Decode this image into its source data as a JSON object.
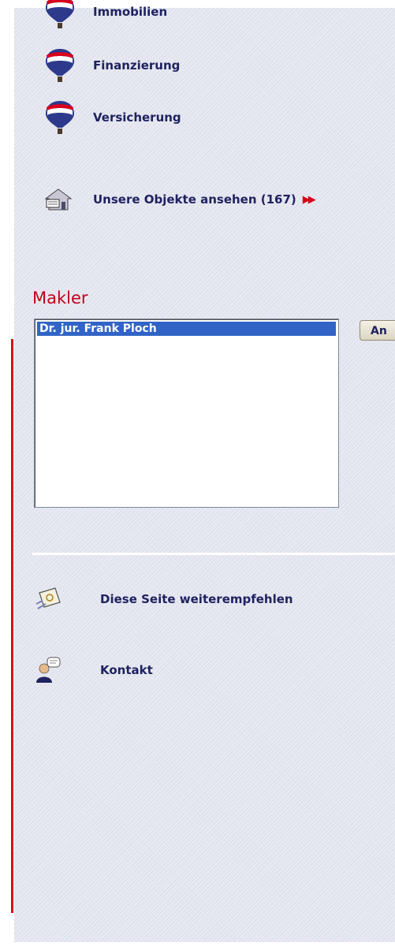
{
  "nav": {
    "items": [
      {
        "label": "Immobilien",
        "icon": "remax-balloon-icon"
      },
      {
        "label": "Finanzierung",
        "icon": "remax-balloon-icon"
      },
      {
        "label": "Versicherung",
        "icon": "remax-balloon-icon"
      }
    ]
  },
  "objects_link": {
    "label": "Unsere Objekte ansehen (167)",
    "arrow": "▶▶",
    "icon": "house-icon"
  },
  "makler": {
    "title": "Makler",
    "options": [
      "Dr. jur. Frank Ploch"
    ],
    "selected": "Dr. jur. Frank Ploch",
    "button_label": "An"
  },
  "footer_links": [
    {
      "label": "Diese Seite weiterempfehlen",
      "icon": "recommend-icon"
    },
    {
      "label": "Kontakt",
      "icon": "contact-person-icon"
    }
  ],
  "colors": {
    "accent_red": "#c0001a",
    "link_navy": "#1f2260",
    "selection_blue": "#3164c6",
    "panel_bg": "#e4e6f0"
  }
}
